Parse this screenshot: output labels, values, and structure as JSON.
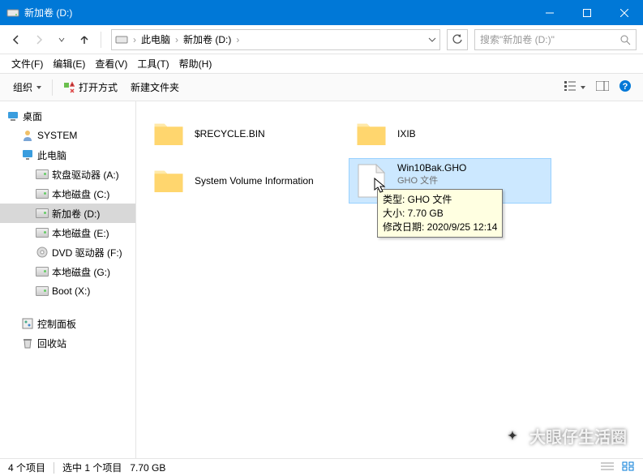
{
  "window": {
    "title": "新加卷 (D:)"
  },
  "breadcrumbs": [
    "此电脑",
    "新加卷 (D:)"
  ],
  "search": {
    "placeholder": "搜索\"新加卷 (D:)\""
  },
  "menu": {
    "file": "文件(F)",
    "edit": "编辑(E)",
    "view": "查看(V)",
    "tools": "工具(T)",
    "help": "帮助(H)"
  },
  "toolbar": {
    "organize": "组织",
    "open_with": "打开方式",
    "new_folder": "新建文件夹"
  },
  "sidebar": {
    "desktop": "桌面",
    "system": "SYSTEM",
    "this_pc": "此电脑",
    "drives": [
      "软盘驱动器 (A:)",
      "本地磁盘 (C:)",
      "新加卷 (D:)",
      "本地磁盘 (E:)",
      "DVD 驱动器 (F:)",
      "本地磁盘 (G:)",
      "Boot (X:)"
    ],
    "control_panel": "控制面板",
    "recycle_bin": "回收站"
  },
  "files": [
    {
      "name": "$RECYCLE.BIN",
      "type": "folder"
    },
    {
      "name": "IXIB",
      "type": "folder"
    },
    {
      "name": "System Volume Information",
      "type": "folder"
    },
    {
      "name": "Win10Bak.GHO",
      "type": "file",
      "sub1": "GHO 文件",
      "sub2": "7.70 GB",
      "selected": true
    }
  ],
  "tooltip": {
    "line1": "类型: GHO 文件",
    "line2": "大小: 7.70 GB",
    "line3": "修改日期: 2020/9/25 12:14"
  },
  "status": {
    "count": "4 个项目",
    "selected": "选中 1 个项目",
    "size": "7.70 GB"
  },
  "watermark": "大眼仔生活圈"
}
